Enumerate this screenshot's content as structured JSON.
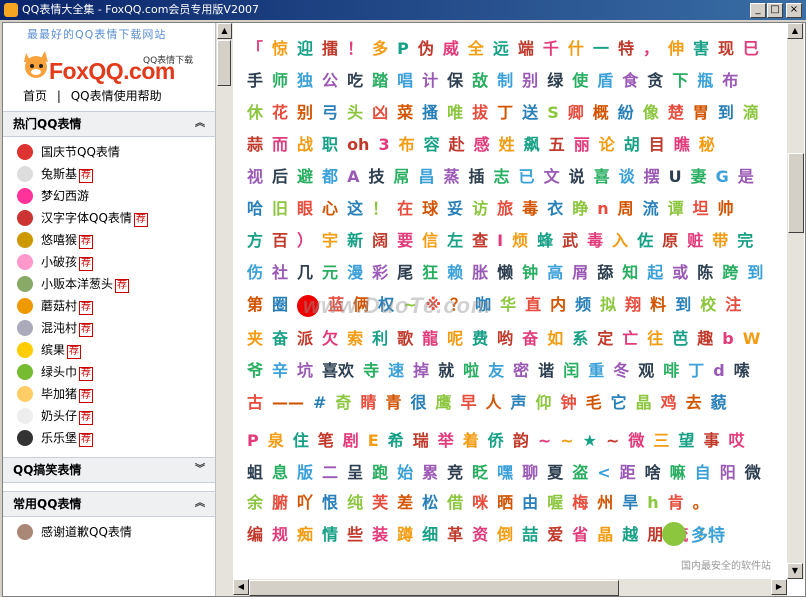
{
  "window": {
    "title": "QQ表情大全集 - FoxQQ.com会员专用版V2007",
    "min": "_",
    "max": "□",
    "close": "×"
  },
  "header": {
    "slogan": "最最好的QQ表情下载网站",
    "logo": "FoxQQ.com",
    "logo_sub": "QQ表情下载",
    "nav": [
      "首页",
      "|",
      "QQ表情使用帮助"
    ]
  },
  "sections": [
    {
      "title": "热门QQ表情",
      "items": [
        {
          "label": "国庆节QQ表情",
          "tag": "",
          "color": "#d33"
        },
        {
          "label": "兔斯基",
          "tag": "荐",
          "color": "#ddd"
        },
        {
          "label": "梦幻西游",
          "tag": "",
          "color": "#f39"
        },
        {
          "label": "汉字字体QQ表情",
          "tag": "荐",
          "color": "#c33"
        },
        {
          "label": "悠嘻猴",
          "tag": "荐",
          "color": "#c90"
        },
        {
          "label": "小破孩",
          "tag": "荐",
          "color": "#f9c"
        },
        {
          "label": "小贩本洋葱头",
          "tag": "荐",
          "color": "#8a6"
        },
        {
          "label": "蘑菇村",
          "tag": "荐",
          "color": "#e90"
        },
        {
          "label": "混沌村",
          "tag": "荐",
          "color": "#aab"
        },
        {
          "label": "缤果",
          "tag": "荐",
          "color": "#fc0"
        },
        {
          "label": "绿头巾",
          "tag": "荐",
          "color": "#7b3"
        },
        {
          "label": "毕加猪",
          "tag": "荐",
          "color": "#fc6"
        },
        {
          "label": "奶头仔",
          "tag": "荐",
          "color": "#eee"
        },
        {
          "label": "乐乐堡",
          "tag": "荐",
          "color": "#333"
        }
      ]
    },
    {
      "title": "QQ搞笑表情",
      "items": []
    },
    {
      "title": "常用QQ表情",
      "items": [
        {
          "label": "感谢道歉QQ表情",
          "tag": "",
          "color": "#a87"
        }
      ]
    }
  ],
  "content": {
    "rows": [
      "「 惊 迎 擂 ！ 多 P 伪 威 全 远 端 千 什 一 特 ， 伸 害 现 巳",
      "手 师 独 公 吃 踏 唱 计 保 敌 制 别 绿 使 盾 食 贪 下 瓶 布",
      "休 花 别 弓 头 凶 菜 搔 唯 拔 丁 送 S 卿 概 紛 像 楚 胃 到 滴",
      "蒜 而 战 职 oh 3 布 容 赴 感 姓 飙 五 丽 论 胡 目 瞧 秘",
      "视 后 避 都 A 技 屌 昌 蒸 插 志 已 文 说 喜 谈 摆 U 妻 G 是",
      "哈 旧 眼 心 这 ！ 在 球 妥 访 旅 毒 衣 睁 n 周 流 谭 坦 帅",
      "方 百 ） 宇 新 阔 要 信 左 查 I 烦 蜂 武 毒 入 佐 原 赃 带 完",
      "伤 社 几 元 漫 彩 尾 狂 赖 胀 懒 钟 高 屑 舔 知 起 或 陈 跨 到",
      "第 圈 ● 蓝 俩 权 ~ ※ ？ 咖 华 直 内 频 拟 翔 料 到 校 注",
      "夹 奋 派 欠 索 利 歌 龍 呢 费 哟 奋 如 系 定 亡 往 芭 趣 b W",
      "爷 辛 坑 喜欢 寺 速 掉 就 啦 友 密 谐 闰 重 冬 观 啡 丁 d 嗦",
      "古 —— # 奇 睛 青 很 鹰 早 人 声 仰 钟 毛 它 晶 鸡 去 藐",
      "P 泉 住 笔 剧 E 希 瑞 举 着 侨 韵 ~ ~ ★ ~ 微 三 望 事 哎",
      "蛆 息 版 二 呈 跑 始 累 竞 眨 嘿 聊 夏 盗 < 距 啥 嘛 自 阳 微",
      "余 腑 吖 恨 纯 芙 差 松 借 咪 晒 由 喔 梅 州 旱 h 肯 。",
      "编 规 痴 情 些 装 蹲 细 革 资 倒 喆 爱 省 晶 越 朋 流 ！"
    ],
    "watermark": "www.DuoTe.com",
    "brand_name": "多特",
    "brand_text": "国内最安全的软件站",
    "accent": "#e00"
  }
}
